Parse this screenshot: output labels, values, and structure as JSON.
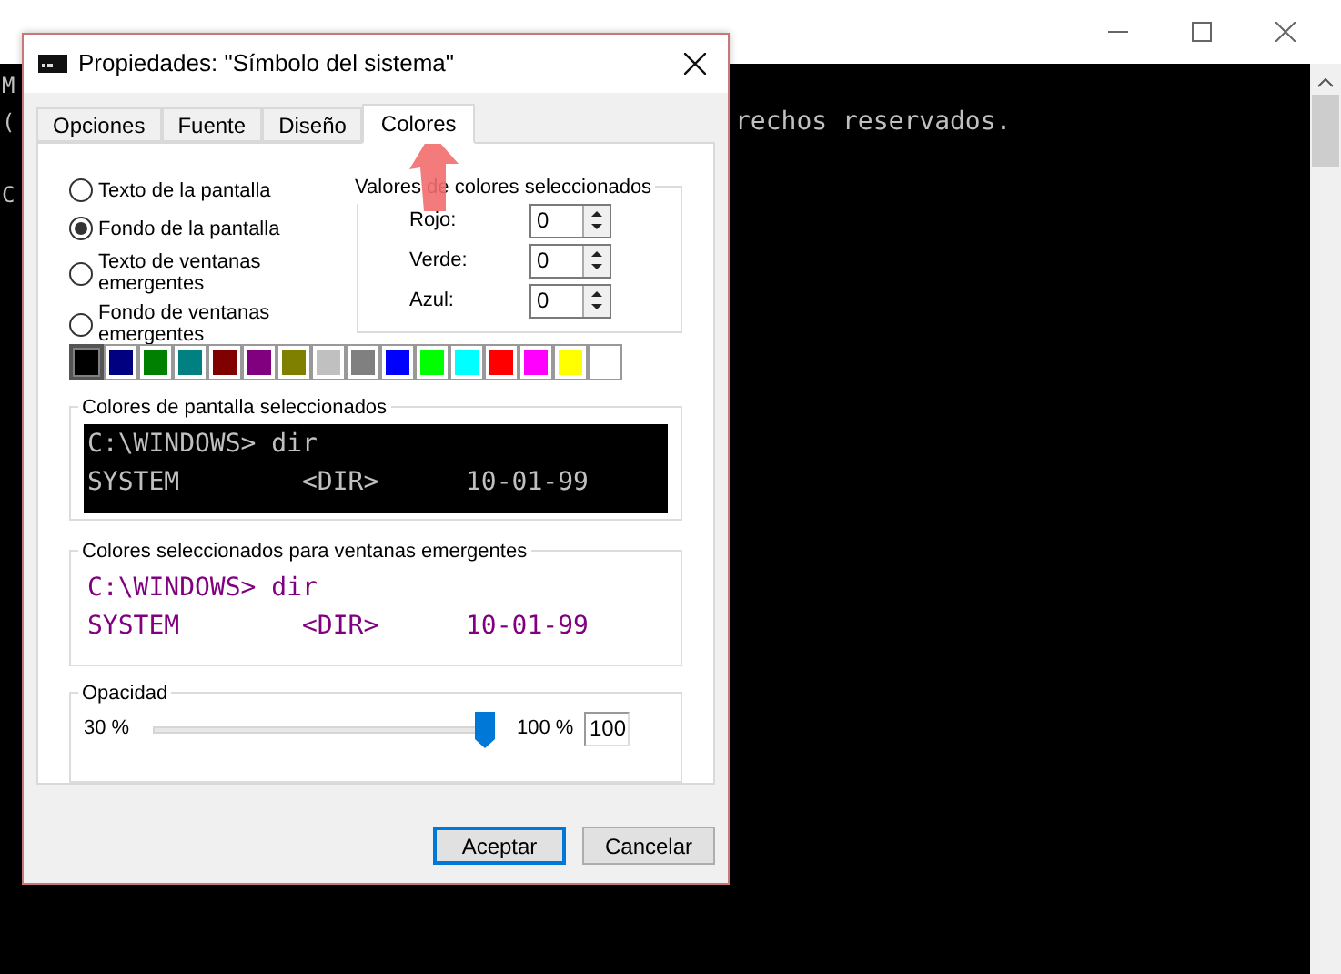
{
  "console": {
    "lines": [
      "M",
      "(",
      "C"
    ],
    "visible_text": "rechos reservados."
  },
  "dialog": {
    "title": "Propiedades: \"Símbolo del sistema\"",
    "tabs": [
      {
        "label": "Opciones",
        "selected": false
      },
      {
        "label": "Fuente",
        "selected": false
      },
      {
        "label": "Diseño",
        "selected": false
      },
      {
        "label": "Colores",
        "selected": true
      }
    ],
    "targets": [
      {
        "label": "Texto de la pantalla",
        "selected": false
      },
      {
        "label": "Fondo de la pantalla",
        "selected": true
      },
      {
        "label": "Texto de ventanas emergentes",
        "selected": false
      },
      {
        "label": "Fondo de ventanas emergentes",
        "selected": false
      }
    ],
    "values_group": {
      "title": "Valores de colores seleccionados",
      "fields": [
        {
          "label": "Rojo:",
          "value": "0"
        },
        {
          "label": "Verde:",
          "value": "0"
        },
        {
          "label": "Azul:",
          "value": "0"
        }
      ]
    },
    "swatches": [
      {
        "color": "#000000",
        "selected": true
      },
      {
        "color": "#000080",
        "selected": false
      },
      {
        "color": "#008000",
        "selected": false
      },
      {
        "color": "#008080",
        "selected": false
      },
      {
        "color": "#800000",
        "selected": false
      },
      {
        "color": "#800080",
        "selected": false
      },
      {
        "color": "#808000",
        "selected": false
      },
      {
        "color": "#c0c0c0",
        "selected": false
      },
      {
        "color": "#808080",
        "selected": false
      },
      {
        "color": "#0000ff",
        "selected": false
      },
      {
        "color": "#00ff00",
        "selected": false
      },
      {
        "color": "#00ffff",
        "selected": false
      },
      {
        "color": "#ff0000",
        "selected": false
      },
      {
        "color": "#ff00ff",
        "selected": false
      },
      {
        "color": "#ffff00",
        "selected": false
      },
      {
        "color": "#ffffff",
        "selected": false
      }
    ],
    "screen_preview": {
      "title": "Colores de pantalla seleccionados",
      "lines": [
        [
          "C:\\WINDOWS> dir"
        ],
        [
          "SYSTEM",
          "<DIR>",
          "10-01-99"
        ]
      ]
    },
    "popup_preview": {
      "title": "Colores seleccionados para ventanas emergentes",
      "lines": [
        [
          "C:\\WINDOWS> dir"
        ],
        [
          "SYSTEM",
          "<DIR>",
          "10-01-99"
        ]
      ]
    },
    "opacity": {
      "title": "Opacidad",
      "min_label": "30 %",
      "max_label": "100 %",
      "level": 1.0,
      "value": "100"
    },
    "buttons": [
      {
        "label": "Aceptar",
        "default": true
      },
      {
        "label": "Cancelar",
        "default": false
      }
    ]
  }
}
